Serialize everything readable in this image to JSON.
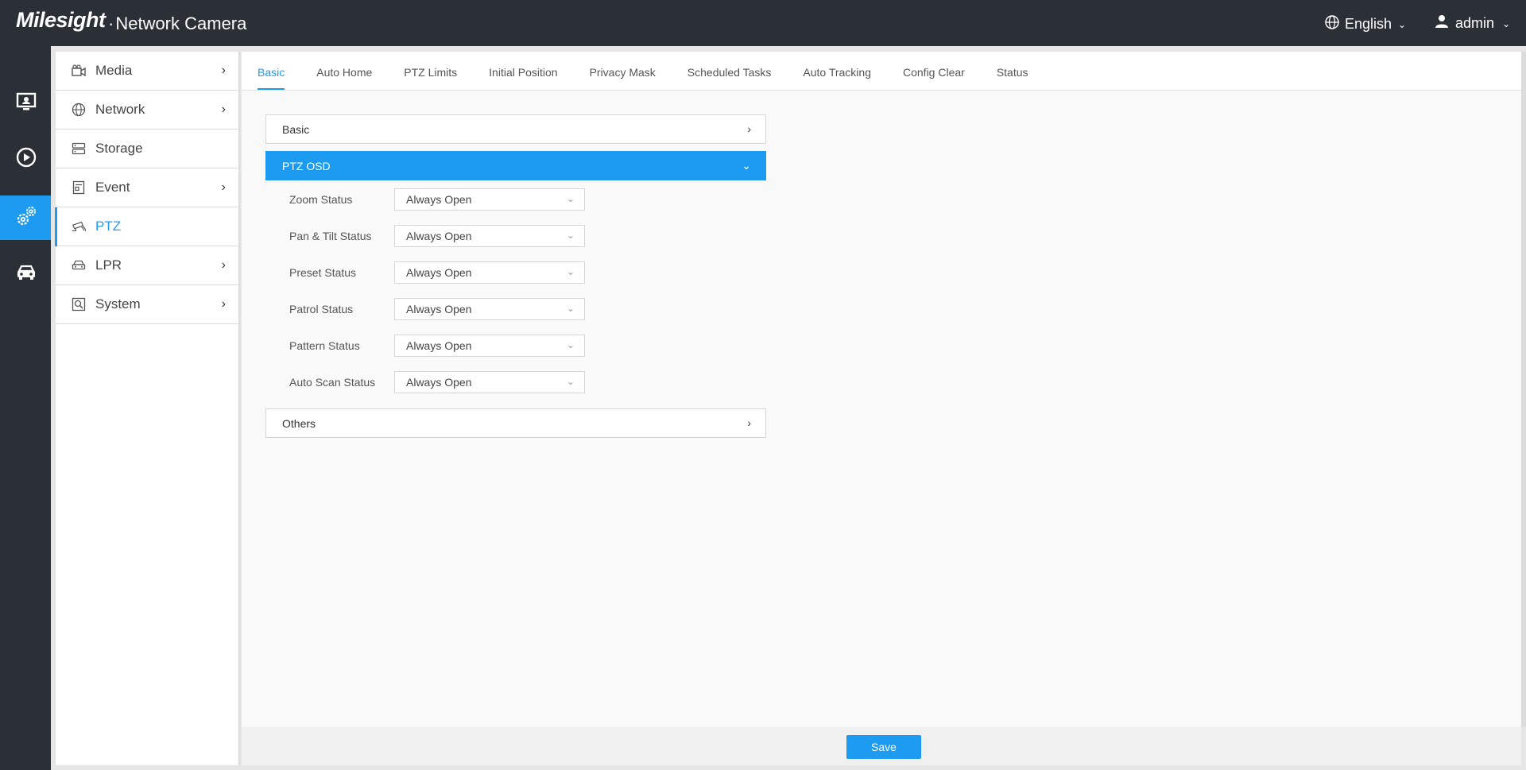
{
  "header": {
    "logo": "Milesight",
    "product_dot": "·",
    "product": "Network Camera",
    "language": "English",
    "user": "admin",
    "caret": "⌄"
  },
  "rail": {
    "items": [
      {
        "icon": "monitor-icon"
      },
      {
        "icon": "playback-icon"
      },
      {
        "icon": "settings-icon",
        "active": true
      },
      {
        "icon": "vehicle-icon"
      }
    ]
  },
  "sidebar": {
    "items": [
      {
        "label": "Media",
        "icon": "camera-icon",
        "has_children": true
      },
      {
        "label": "Network",
        "icon": "globe-icon",
        "has_children": true
      },
      {
        "label": "Storage",
        "icon": "storage-icon",
        "has_children": false
      },
      {
        "label": "Event",
        "icon": "event-icon",
        "has_children": true
      },
      {
        "label": "PTZ",
        "icon": "ptz-icon",
        "has_children": false,
        "active": true
      },
      {
        "label": "LPR",
        "icon": "car-icon",
        "has_children": true
      },
      {
        "label": "System",
        "icon": "system-icon",
        "has_children": true
      }
    ],
    "chevron": "›"
  },
  "tabs": [
    "Basic",
    "Auto Home",
    "PTZ Limits",
    "Initial Position",
    "Privacy Mask",
    "Scheduled Tasks",
    "Auto Tracking",
    "Config Clear",
    "Status"
  ],
  "panels": {
    "basic": "Basic",
    "ptz_osd": "PTZ OSD",
    "others": "Others",
    "closed_chevron": "›",
    "open_chevron": "⌄"
  },
  "osd_fields": [
    {
      "label": "Zoom Status",
      "value": "Always Open"
    },
    {
      "label": "Pan & Tilt Status",
      "value": "Always Open"
    },
    {
      "label": "Preset Status",
      "value": "Always Open"
    },
    {
      "label": "Patrol Status",
      "value": "Always Open"
    },
    {
      "label": "Pattern Status",
      "value": "Always Open"
    },
    {
      "label": "Auto Scan Status",
      "value": "Always Open"
    }
  ],
  "select_chevron": "⌄",
  "footer": {
    "save_label": "Save"
  },
  "colors": {
    "accent": "#1c9bf0",
    "topbar": "#2b2f36"
  }
}
